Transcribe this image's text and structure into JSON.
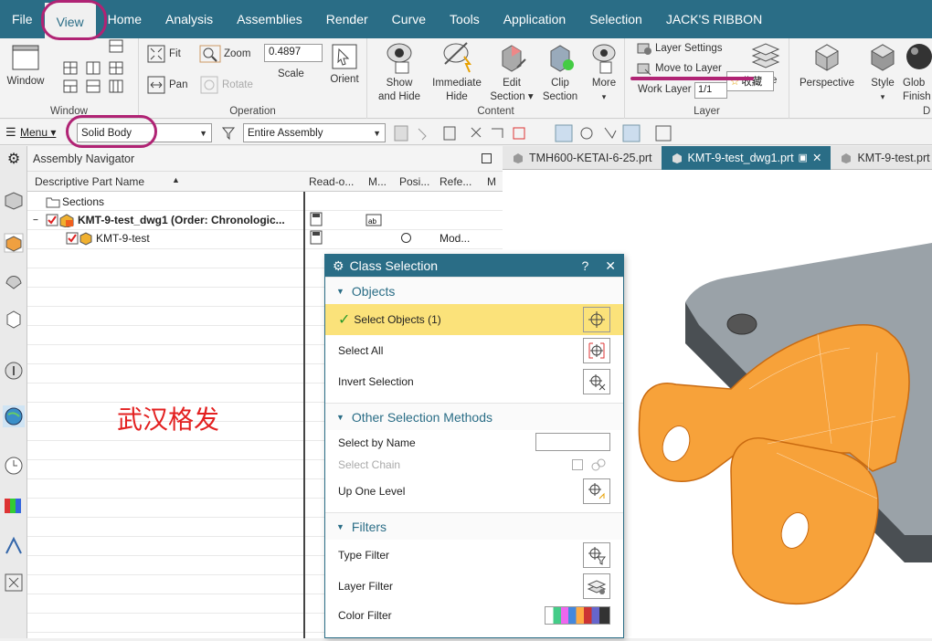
{
  "menu": [
    "File",
    "View",
    "Home",
    "Analysis",
    "Assemblies",
    "Render",
    "Curve",
    "Tools",
    "Application",
    "Selection",
    "JACK'S RIBBON"
  ],
  "active_menu": "View",
  "ribbon": {
    "window_group": {
      "label": "Window",
      "button": "Window"
    },
    "operation_group": {
      "label": "Operation",
      "fit": "Fit",
      "zoom": "Zoom",
      "zoom_value": "0.4897",
      "scale": "Scale",
      "pan": "Pan",
      "rotate": "Rotate",
      "orient": "Orient"
    },
    "content_group": {
      "label": "Content",
      "show_hide": [
        "Show",
        "and Hide"
      ],
      "immediate_hide": [
        "Immediate",
        "Hide"
      ],
      "edit_section": [
        "Edit",
        "Section ▾"
      ],
      "clip_section": [
        "Clip",
        "Section"
      ],
      "more": "More"
    },
    "layer_group": {
      "label": "Layer",
      "layer_settings": "Layer Settings",
      "move_to_layer": "Move to Layer",
      "work_layer": "Work Layer",
      "work_layer_value": "1/1"
    },
    "visual_group": {
      "label": "D",
      "perspective": "Perspective",
      "style": "Style",
      "finish": [
        "Glob",
        "Finish"
      ]
    },
    "tooltip": "收藏"
  },
  "filterbar": {
    "menu": "Menu ▾",
    "type_filter": "Solid Body",
    "scope": "Entire Assembly"
  },
  "navigator": {
    "title": "Assembly Navigator",
    "columns": [
      "Descriptive Part Name",
      "Read-o...",
      "M...",
      "Posi...",
      "Refe...",
      "M"
    ],
    "rows": [
      {
        "name": "Sections",
        "ref": ""
      },
      {
        "name": "KMT-9-test_dwg1 (Order: Chronologic...",
        "ref": ""
      },
      {
        "name": "KMT-9-test",
        "ref": "Mod..."
      }
    ]
  },
  "tabs": [
    {
      "label": "TMH600-KETAI-6-25.prt"
    },
    {
      "label": "KMT-9-test_dwg1.prt"
    },
    {
      "label": "KMT-9-test.prt"
    }
  ],
  "dialog": {
    "title": "Class Selection",
    "help": "?",
    "close": "✕",
    "objects": {
      "header": "Objects",
      "select_objects": "Select Objects (1)",
      "select_all": "Select All",
      "invert": "Invert Selection"
    },
    "other": {
      "header": "Other Selection Methods",
      "by_name": "Select by Name",
      "chain": "Select Chain",
      "up_level": "Up One Level"
    },
    "filters": {
      "header": "Filters",
      "type": "Type Filter",
      "layer": "Layer Filter",
      "color": "Color Filter"
    }
  },
  "watermark": "武汉格发"
}
